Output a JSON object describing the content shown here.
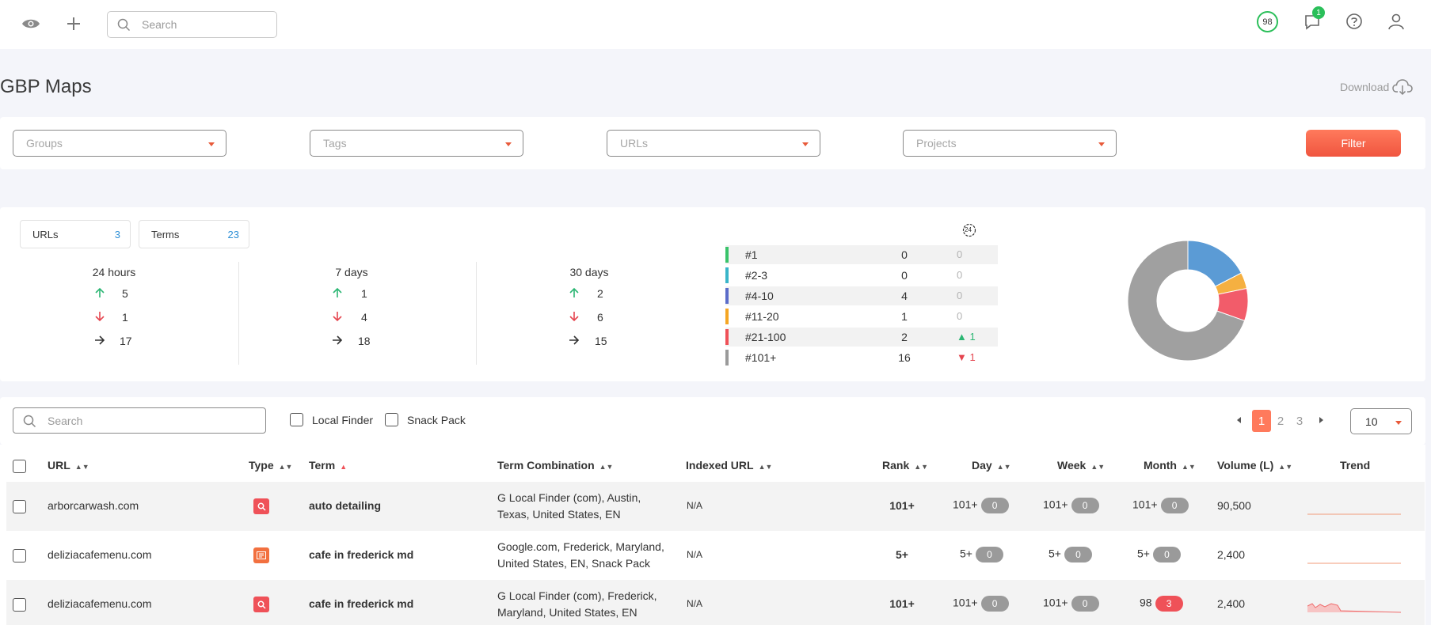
{
  "topbar": {
    "search_placeholder": "Search",
    "score": "98",
    "notifications": "1"
  },
  "header": {
    "title": "GBP Maps",
    "download_label": "Download"
  },
  "filters": {
    "groups": "Groups",
    "tags": "Tags",
    "urls": "URLs",
    "projects": "Projects",
    "filter_button": "Filter"
  },
  "summary": {
    "urls_label": "URLs",
    "urls_count": "3",
    "terms_label": "Terms",
    "terms_count": "23",
    "periods": [
      {
        "label": "24 hours",
        "up": "5",
        "down": "1",
        "same": "17"
      },
      {
        "label": "7 days",
        "up": "1",
        "down": "4",
        "same": "18"
      },
      {
        "label": "30 days",
        "up": "2",
        "down": "6",
        "same": "15"
      }
    ],
    "period_icon_label": "24",
    "ranks": [
      {
        "name": "#1",
        "count": "0",
        "change": "0",
        "dir": "none",
        "color": "#39c36a"
      },
      {
        "name": "#2-3",
        "count": "0",
        "change": "0",
        "dir": "none",
        "color": "#39b5c9"
      },
      {
        "name": "#4-10",
        "count": "4",
        "change": "0",
        "dir": "none",
        "color": "#5b6cc9"
      },
      {
        "name": "#11-20",
        "count": "1",
        "change": "0",
        "dir": "none",
        "color": "#f5a623"
      },
      {
        "name": "#21-100",
        "count": "2",
        "change": "1",
        "dir": "up",
        "color": "#ef5158"
      },
      {
        "name": "#101+",
        "count": "16",
        "change": "1",
        "dir": "down",
        "color": "#9a9a9a"
      }
    ],
    "donut": [
      {
        "name": "#4-10",
        "value": 4,
        "color": "#5b9bd5"
      },
      {
        "name": "#11-20",
        "value": 1,
        "color": "#f5b041"
      },
      {
        "name": "#21-100",
        "value": 2,
        "color": "#f25c6a"
      },
      {
        "name": "#101+",
        "value": 16,
        "color": "#a0a0a0"
      }
    ]
  },
  "toolbar": {
    "search_placeholder": "Search",
    "local_finder": "Local Finder",
    "snack_pack": "Snack Pack",
    "pages": [
      "1",
      "2",
      "3"
    ],
    "per_page": "10"
  },
  "table": {
    "headers": {
      "url": "URL",
      "type": "Type",
      "term": "Term",
      "term_combination": "Term Combination",
      "indexed_url": "Indexed URL",
      "rank": "Rank",
      "day": "Day",
      "week": "Week",
      "month": "Month",
      "volume": "Volume (L)",
      "trend": "Trend"
    },
    "rows": [
      {
        "url": "arborcarwash.com",
        "type_icon": "search-icon",
        "type_color": "#ef5158",
        "term": "auto detailing",
        "combo1": "G Local Finder (com), Austin,",
        "combo2": "Texas, United States, EN",
        "indexed": "N/A",
        "rank": "101+",
        "day": "101+",
        "day_chg": "0",
        "week": "101+",
        "week_chg": "0",
        "month": "101+",
        "month_chg": "0",
        "month_chg_color": "gray",
        "volume": "90,500"
      },
      {
        "url": "deliziacafemenu.com",
        "type_icon": "snack-pack-icon",
        "type_color": "#f2703f",
        "term": "cafe in frederick md",
        "combo1": "Google.com, Frederick, Maryland,",
        "combo2": "United States, EN, Snack Pack",
        "indexed": "N/A",
        "rank": "5+",
        "day": "5+",
        "day_chg": "0",
        "week": "5+",
        "week_chg": "0",
        "month": "5+",
        "month_chg": "0",
        "month_chg_color": "gray",
        "volume": "2,400"
      },
      {
        "url": "deliziacafemenu.com",
        "type_icon": "search-icon",
        "type_color": "#ef5158",
        "term": "cafe in frederick md",
        "combo1": "G Local Finder (com), Frederick,",
        "combo2": "Maryland, United States, EN",
        "indexed": "N/A",
        "rank": "101+",
        "day": "101+",
        "day_chg": "0",
        "week": "101+",
        "week_chg": "0",
        "month": "98",
        "month_chg": "3",
        "month_chg_color": "red",
        "volume": "2,400"
      }
    ]
  }
}
